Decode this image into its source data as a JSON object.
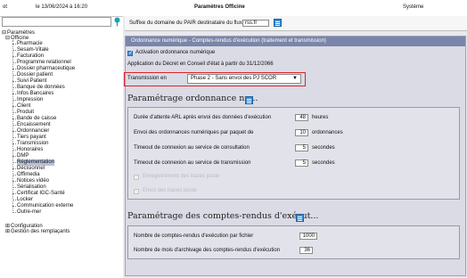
{
  "topbar": {
    "left": "ot",
    "datetime": "le 13/06/2024 à 16:20",
    "title": "Paramètres Officine",
    "right": "Système"
  },
  "tree": {
    "root": "Paramètres",
    "officine": "Officine",
    "children": [
      "Pharmacie",
      "Sesam-Vitale",
      "Facturation",
      "Programme relationnel",
      "Dossier pharmaceutique",
      "Dossier patient",
      "Suivi Patient",
      "Banque de données",
      "Infos Bancaires",
      "Impression",
      "Client",
      "Produit",
      "Bande de caisse",
      "Encaissement",
      "Ordonnancier",
      "Tiers payant",
      "Transmission",
      "Honoraires",
      "DMP",
      "Réglementation",
      "Décisionnel",
      "Offimedia",
      "Notices vidéo",
      "Sérialisation",
      "Certificat IGC-Santé",
      "Locker",
      "Communication externe",
      "Outre-mer"
    ],
    "selected": "Réglementation",
    "after": [
      "Configuration",
      "Gestion des remplaçants"
    ]
  },
  "pair": {
    "label": "Suffixe du domaine du PAIR destinataire du flux",
    "value": "rss.fr"
  },
  "panel": {
    "header": "Ordonnance numérique - Comptes-rendus d'exécution (traitement et transmission)",
    "activation_label": "Activation ordonnance numérique",
    "decret": "Application du Décret en Conseil d'état à partir du 31/12/2066",
    "transmission_label": "Transmission en",
    "transmission_value": "Phase 2 - Sans envoi des PJ SCOR",
    "section1": {
      "title": "Paramétrage ordonnance nu...",
      "rows": [
        {
          "label": "Durée d'attente ARL après envoi des données d'exécution",
          "value": "48",
          "unit": "heures"
        },
        {
          "label": "Envoi des ordonnances numériques par paquet de",
          "value": "10",
          "unit": "ordonnances"
        },
        {
          "label": "Timeout de connexion au service de consultation",
          "value": "5",
          "unit": "secondes"
        },
        {
          "label": "Timeout de connexion au service de transmission",
          "value": "5",
          "unit": "secondes"
        }
      ],
      "disabled_checks": [
        "Enregistrement des traces poste",
        "Envoi des traces poste"
      ]
    },
    "section2": {
      "title": "Paramétrage des comptes-rendus d'exécut...",
      "rows": [
        {
          "label": "Nombre de comptes-rendus d'exécution par fichier",
          "value": "1000"
        },
        {
          "label": "Nombre de mois d'archivage des comptes-rendus d'exécution",
          "value": "36"
        }
      ]
    }
  },
  "colors": {
    "highlight": "#d9252a",
    "accent": "#3a8fd6"
  }
}
